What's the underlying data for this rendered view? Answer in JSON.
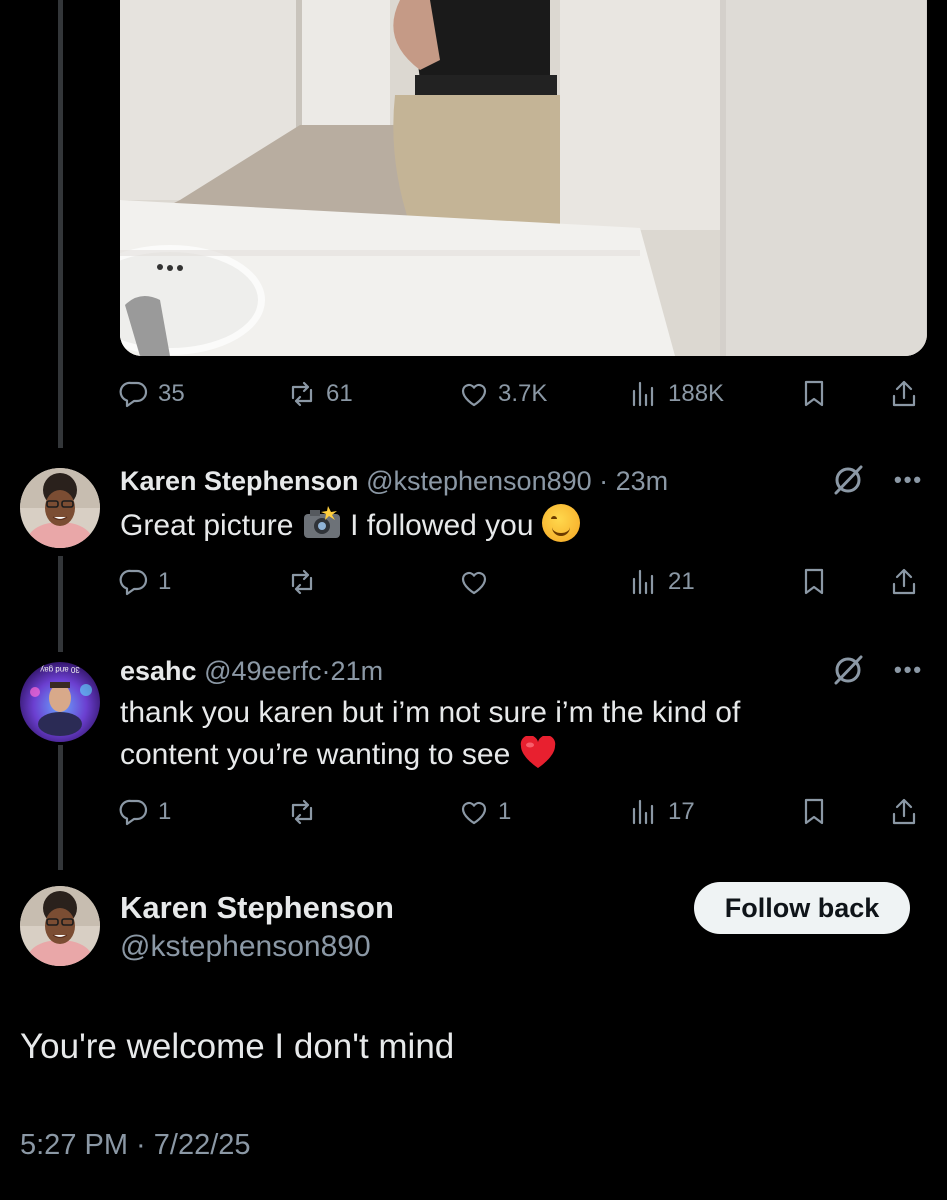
{
  "post_stats": {
    "replies": "35",
    "reposts": "61",
    "likes": "3.7K",
    "views": "188K"
  },
  "replies": [
    {
      "name": "Karen Stephenson",
      "handle": "@kstephenson890",
      "sep": " · ",
      "time": "23m",
      "text_parts": [
        "Great picture ",
        " I followed you "
      ],
      "stats": {
        "replies": "1",
        "reposts": "",
        "likes": "",
        "views": "21"
      }
    },
    {
      "name": "esahc",
      "handle": "@49eerfc",
      "sep": "·",
      "time": "21m",
      "avatar_text": "30 and gay",
      "text_parts": [
        "thank you karen but i’m not sure i’m the kind of content you’re wanting to see "
      ],
      "stats": {
        "replies": "1",
        "reposts": "",
        "likes": "1",
        "views": "17"
      }
    }
  ],
  "main_post": {
    "name": "Karen Stephenson",
    "handle": "@kstephenson890",
    "follow_label": "Follow back",
    "text": "You're welcome I don't mind",
    "timestamp": "5:27 PM · 7/22/25"
  },
  "colors": {
    "background": "#000000",
    "text": "#e7e9ea",
    "muted": "#8b98a5",
    "button_bg": "#eff3f4",
    "heart": "#e8202f"
  },
  "icons": [
    "reply-icon",
    "repost-icon",
    "like-icon",
    "views-icon",
    "bookmark-icon",
    "share-icon",
    "grok-icon",
    "more-icon"
  ]
}
